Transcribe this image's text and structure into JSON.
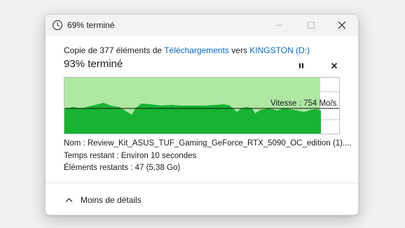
{
  "window": {
    "title": "69% terminé"
  },
  "copy": {
    "prefix": "Copie de 377 éléments de ",
    "source": "Téléchargements",
    "middle": " vers ",
    "destination": "KINGSTON (D:)"
  },
  "progress": {
    "percent_label": "93% terminé",
    "fraction": 0.93
  },
  "graph": {
    "speed_label": "Vitesse : 754 Mo/s",
    "colors": {
      "fill": "#17b331",
      "area": "#aee8a3",
      "line": "#111111"
    }
  },
  "details": {
    "name_label": "Nom :",
    "name_value": "Review_Kit_ASUS_TUF_Gaming_GeForce_RTX_5090_OC_edition (1)....",
    "time_label": "Temps restant :",
    "time_value": "Environ 10 secondes",
    "items_label": "Éléments restants :",
    "items_value": "47 (5,38 Go)"
  },
  "footer": {
    "toggle_label": "Moins de détails"
  },
  "icons": [
    "copy-progress-icon",
    "minimize-icon",
    "maximize-icon",
    "close-icon",
    "pause-icon",
    "cancel-icon",
    "chevron-up-icon"
  ]
}
